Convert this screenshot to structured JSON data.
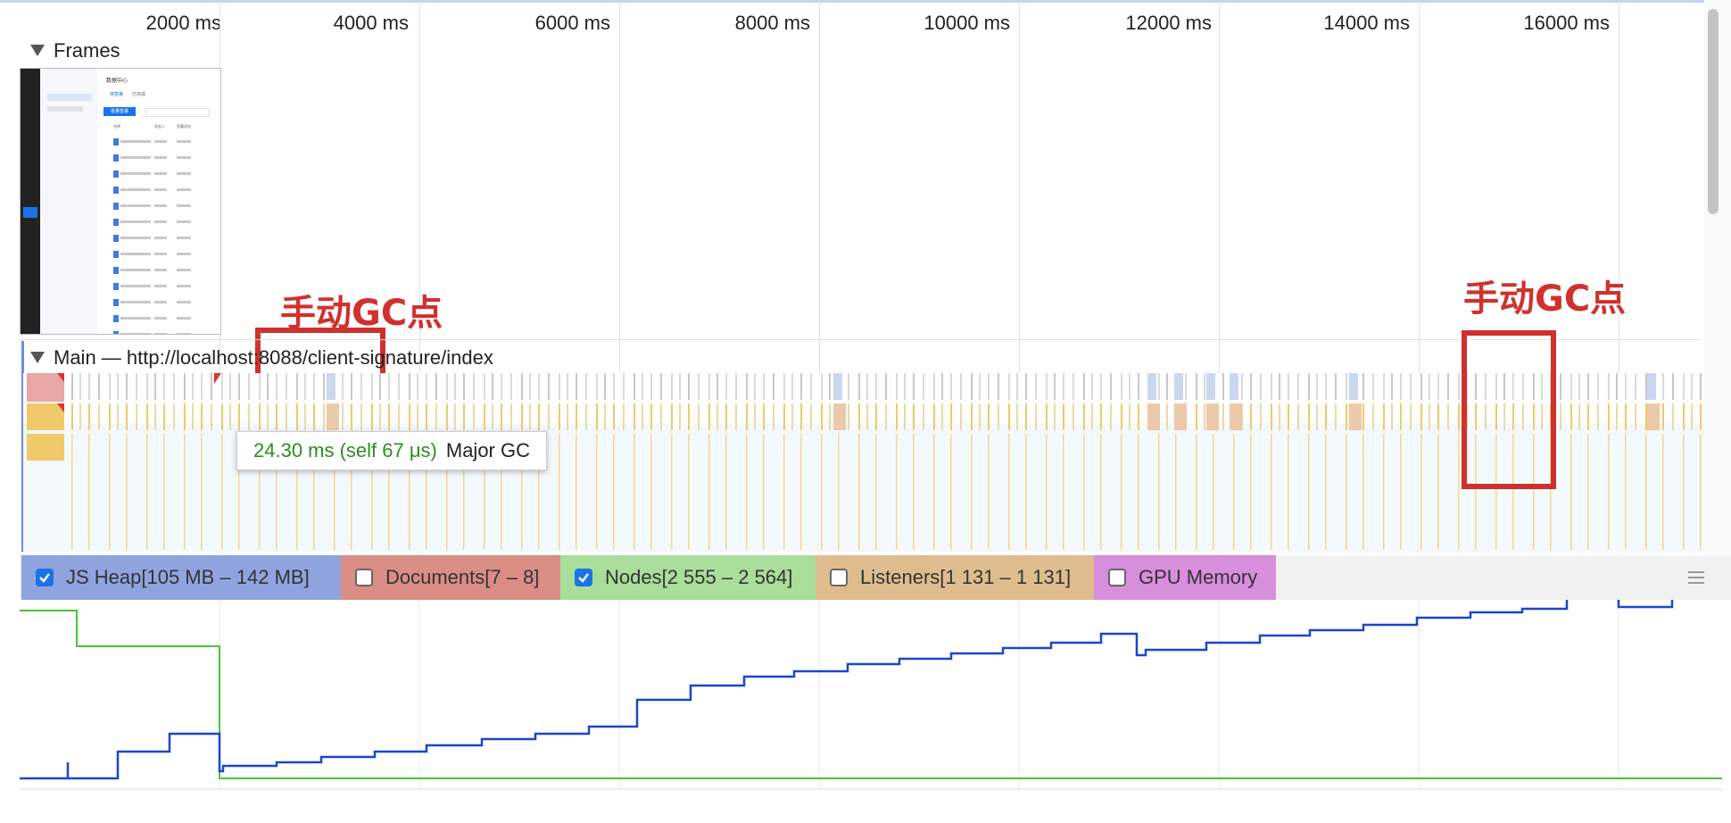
{
  "ruler": {
    "ticks": [
      "2000 ms",
      "4000 ms",
      "6000 ms",
      "8000 ms",
      "10000 ms",
      "12000 ms",
      "14000 ms",
      "16000 ms"
    ]
  },
  "frames": {
    "title": "Frames",
    "thumbnail": {
      "title": "数据中心",
      "tabs": [
        "待签署",
        "已完成"
      ],
      "button": "批量签署",
      "columns": [
        "名称",
        "发起人",
        "签署状态"
      ]
    }
  },
  "main": {
    "title": "Main — http://localhost:8088/client-signature/index"
  },
  "tooltip": {
    "duration": "24.30 ms (self 67 μs)",
    "event": "Major GC",
    "duration_color": "#2e8b22"
  },
  "annotations": [
    {
      "text": "手动GC点"
    },
    {
      "text": "手动GC点"
    }
  ],
  "counters": [
    {
      "label": "JS Heap[105 MB – 142 MB]",
      "checked": true,
      "color": "#8fa4df"
    },
    {
      "label": "Documents[7 – 8]",
      "checked": false,
      "color": "#da8d85"
    },
    {
      "label": "Nodes[2 555 – 2 564]",
      "checked": true,
      "color": "#a8dd9a"
    },
    {
      "label": "Listeners[1 131 – 1 131]",
      "checked": false,
      "color": "#dfbc8d"
    },
    {
      "label": "GPU Memory",
      "checked": false,
      "color": "#d78edb"
    }
  ],
  "colors": {
    "heap_line": "#1a47c9",
    "nodes_line": "#4cc03c",
    "annotation": "#d0312d",
    "scripting": "#f0c96a",
    "gc_stripe": "#e8a6a6"
  }
}
